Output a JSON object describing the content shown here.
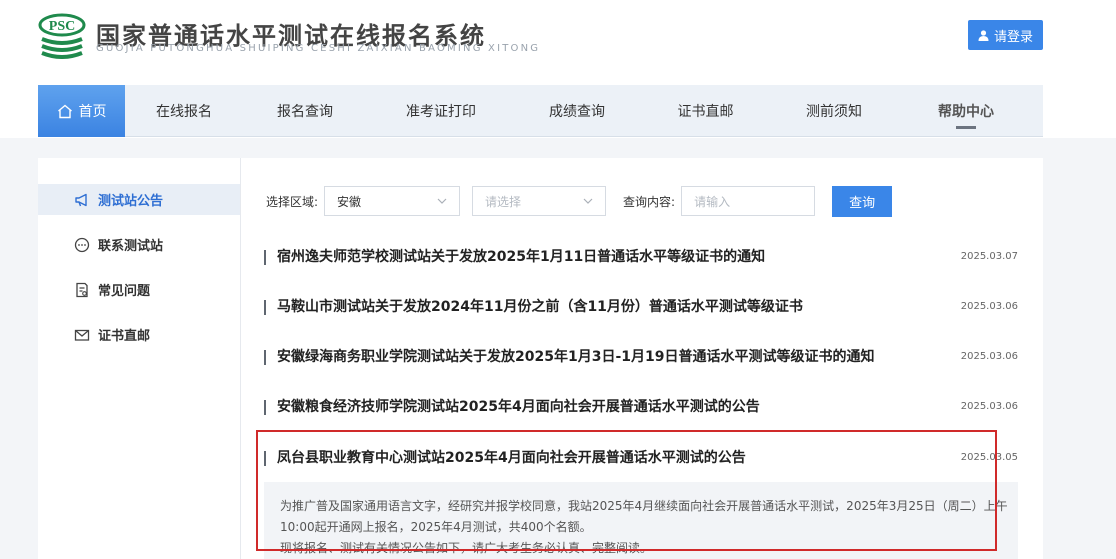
{
  "header": {
    "logo_text": "PSC",
    "title": "国家普通话水平测试在线报名系统",
    "pinyin": "GUOJIA PUTONGHUA SHUIPING CESHI ZAIXIAN BAOMING XITONG",
    "login_label": "请登录"
  },
  "nav": {
    "items": [
      {
        "label": "首页"
      },
      {
        "label": "在线报名"
      },
      {
        "label": "报名查询"
      },
      {
        "label": "准考证打印"
      },
      {
        "label": "成绩查询"
      },
      {
        "label": "证书直邮"
      },
      {
        "label": "测前须知"
      },
      {
        "label": "帮助中心"
      }
    ]
  },
  "sidebar": {
    "items": [
      {
        "label": "测试站公告"
      },
      {
        "label": "联系测试站"
      },
      {
        "label": "常见问题"
      },
      {
        "label": "证书直邮"
      }
    ]
  },
  "filters": {
    "region_label": "选择区域:",
    "region_value": "安徽",
    "sub_placeholder": "请选择",
    "content_label": "查询内容:",
    "content_placeholder": "请输入",
    "query_label": "查询"
  },
  "notices": [
    {
      "title": "宿州逸夫师范学校测试站关于发放2025年1月11日普通话水平等级证书的通知",
      "date": "2025.03.07"
    },
    {
      "title": "马鞍山市测试站关于发放2024年11月份之前（含11月份）普通话水平测试等级证书",
      "date": "2025.03.06"
    },
    {
      "title": "安徽绿海商务职业学院测试站关于发放2025年1月3日-1月19日普通话水平测试等级证书的通知",
      "date": "2025.03.06"
    },
    {
      "title": "安徽粮食经济技师学院测试站2025年4月面向社会开展普通话水平测试的公告",
      "date": "2025.03.06"
    },
    {
      "title": "凤台县职业教育中心测试站2025年4月面向社会开展普通话水平测试的公告",
      "date": "2025.03.05"
    }
  ],
  "excerpt": {
    "line1": "为推广普及国家通用语言文字，经研究并报学校同意，我站2025年4月继续面向社会开展普通话水平测试，2025年3月25日（周二）上午",
    "line2": "10:00起开通网上报名，2025年4月测试，共400个名额。",
    "line3": "现将报名、测试有关情况公告如下，请广大考生务必认真、完整阅读。"
  },
  "colors": {
    "accent": "#3a86e8",
    "logo_green": "#1f8a4c",
    "highlight": "#d02a2a"
  }
}
